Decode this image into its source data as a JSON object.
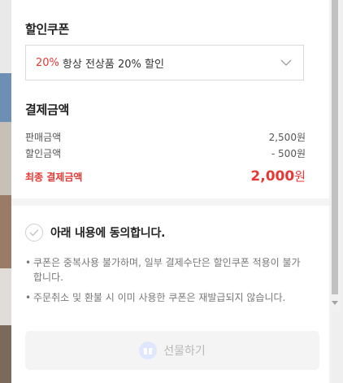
{
  "coupon": {
    "title": "할인쿠폰",
    "selected_highlight": "20%",
    "selected_text": "항상 전상품 20% 할인"
  },
  "payment": {
    "title": "결제금액",
    "rows": [
      {
        "label": "판매금액",
        "value": "2,500원"
      },
      {
        "label": "할인금액",
        "value": "- 500원"
      }
    ],
    "final_label": "최종 결제금액",
    "final_amount": "2,000",
    "final_unit": "원"
  },
  "agreement": {
    "label": "아래 내용에 동의합니다.",
    "notes": [
      "쿠폰은 중복사용 불가하며, 일부 결제수단은 할인쿠폰 적용이 불가합니다.",
      "주문취소 및 환불 시 이미 사용한 쿠폰은 재발급되지 않습니다."
    ],
    "bullet": "•"
  },
  "action": {
    "gift_label": "선물하기"
  },
  "colors": {
    "accent_red": "#e53935",
    "disabled_text": "#b8b8b8"
  }
}
